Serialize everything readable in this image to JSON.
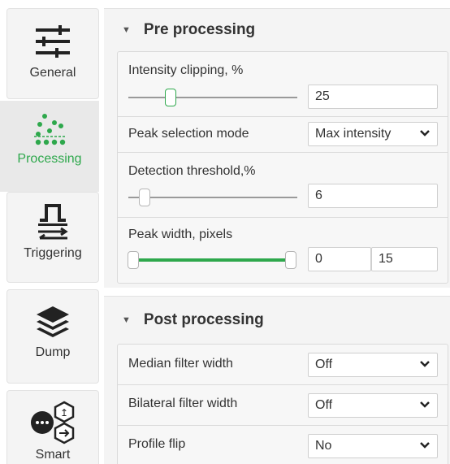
{
  "sidebar": {
    "items": [
      {
        "label": "General",
        "icon": "sliders-icon",
        "active": false
      },
      {
        "label": "Processing",
        "icon": "dots-processing-icon",
        "active": true
      },
      {
        "label": "Triggering",
        "icon": "trigger-pulse-icon",
        "active": false
      },
      {
        "label": "Dump",
        "icon": "layers-icon",
        "active": false
      },
      {
        "label": "Smart",
        "icon": "smart-gears-icon",
        "active": false
      }
    ]
  },
  "pre": {
    "title": "Pre processing",
    "intensity": {
      "label": "Intensity clipping, %",
      "value": "25",
      "slider_fraction": 0.25
    },
    "peak_mode": {
      "label": "Peak selection mode",
      "value": "Max intensity"
    },
    "threshold": {
      "label": "Detection threshold,%",
      "value": "6",
      "slider_fraction": 0.06
    },
    "peak_width": {
      "label": "Peak width, pixels",
      "min": "0",
      "max": "15"
    }
  },
  "post": {
    "title": "Post processing",
    "median": {
      "label": "Median filter width",
      "value": "Off"
    },
    "bilateral": {
      "label": "Bilateral filter width",
      "value": "Off"
    },
    "flip": {
      "label": "Profile flip",
      "value": "No"
    }
  },
  "colors": {
    "accent": "#2ea84c",
    "panel": "#f4f4f4",
    "active_nav": "#e9e9e9"
  }
}
